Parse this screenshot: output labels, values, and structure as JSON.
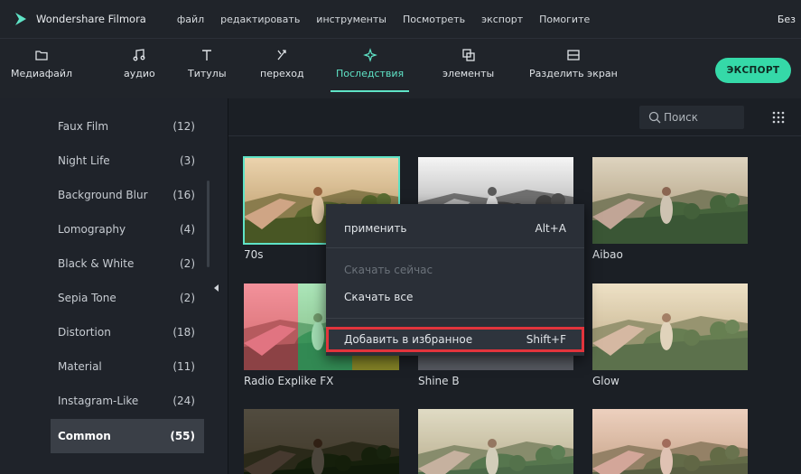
{
  "app": {
    "name": "Wondershare Filmora",
    "title_right": "Без"
  },
  "menu": [
    "файл",
    "редактировать",
    "инструменты",
    "Посмотреть",
    "экспорт",
    "Помогите"
  ],
  "toolbar": {
    "items": [
      {
        "label": "Медиафайл",
        "icon": "folder-icon"
      },
      {
        "label": "аудио",
        "icon": "music-note-icon"
      },
      {
        "label": "Титулы",
        "icon": "text-t-icon"
      },
      {
        "label": "переход",
        "icon": "transition-icon"
      },
      {
        "label": "Последствия",
        "icon": "sparkle-icon",
        "active": true
      },
      {
        "label": "элементы",
        "icon": "layers-icon"
      },
      {
        "label": "Разделить экран",
        "icon": "split-screen-icon"
      }
    ],
    "export_label": "ЭКСПОРТ",
    "accent": "#5fe3c6",
    "export_color": "#35d9a8"
  },
  "sidebar": {
    "categories": [
      {
        "label": "Faux Film",
        "count": "(12)"
      },
      {
        "label": "Night Life",
        "count": "(3)"
      },
      {
        "label": "Background Blur",
        "count": "(16)"
      },
      {
        "label": "Lomography",
        "count": "(4)"
      },
      {
        "label": "Black & White",
        "count": "(2)"
      },
      {
        "label": "Sepia Tone",
        "count": "(2)"
      },
      {
        "label": "Distortion",
        "count": "(18)"
      },
      {
        "label": "Material",
        "count": "(11)"
      },
      {
        "label": "Instagram-Like",
        "count": "(24)"
      },
      {
        "label": "Common",
        "count": "(55)",
        "selected": true
      }
    ]
  },
  "search": {
    "placeholder": "Поиск",
    "icon": "search-icon"
  },
  "effects": [
    {
      "label": "70s",
      "selected": true
    },
    {
      "label": ""
    },
    {
      "label": "Aibao"
    },
    {
      "label": "Radio Explike FX"
    },
    {
      "label": "Shine B"
    },
    {
      "label": "Glow"
    }
  ],
  "context_menu": {
    "apply": {
      "label": "применить",
      "shortcut": "Alt+A"
    },
    "download_now": {
      "label": "Скачать сейчас"
    },
    "download_all": {
      "label": "Скачать все"
    },
    "favorite": {
      "label": "Добавить в избранное",
      "shortcut": "Shift+F"
    },
    "highlight_color": "#e2343c"
  }
}
